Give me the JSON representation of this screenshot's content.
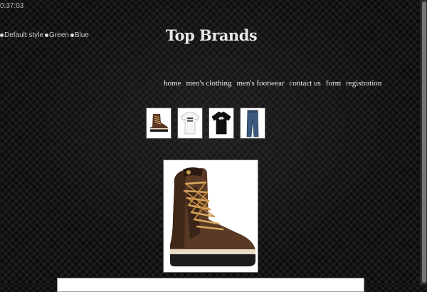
{
  "clock": {
    "time": "0:37:03"
  },
  "style_switcher": {
    "options": [
      {
        "label": "Default style"
      },
      {
        "label": "Green"
      },
      {
        "label": "Blue"
      }
    ]
  },
  "header": {
    "title": "Top Brands"
  },
  "nav": {
    "links": [
      {
        "label": "home"
      },
      {
        "label": "men's clothing"
      },
      {
        "label": "men's footwear"
      },
      {
        "label": "contact us"
      },
      {
        "label": "form"
      },
      {
        "label": "registration"
      }
    ]
  },
  "gallery": {
    "thumbnails": [
      {
        "icon": "boot-icon"
      },
      {
        "icon": "white-tshirt-icon"
      },
      {
        "icon": "black-tshirt-icon"
      },
      {
        "icon": "jeans-icon"
      }
    ],
    "featured": {
      "icon": "boot-icon"
    }
  },
  "colors": {
    "background": "#0b0b0b",
    "text": "#eeeeee",
    "boot_leather": "#5a3a26",
    "boot_laces": "#d9a760"
  }
}
